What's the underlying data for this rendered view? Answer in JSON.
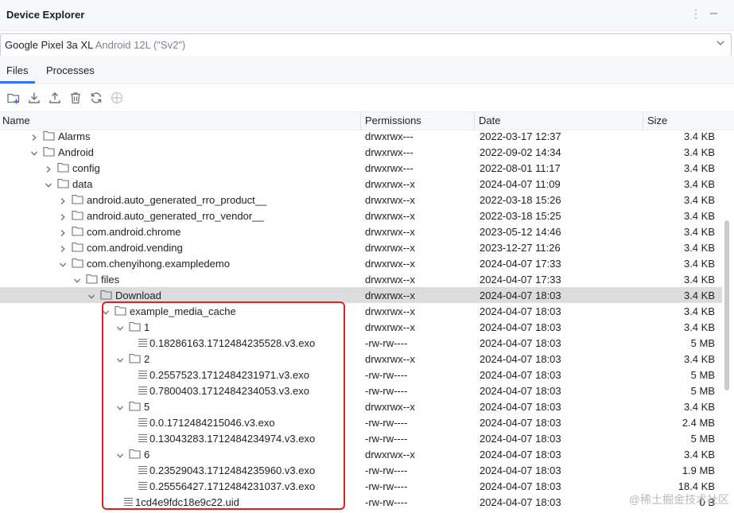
{
  "window": {
    "title": "Device Explorer"
  },
  "device": {
    "name": "Google Pixel 3a XL",
    "version": "Android 12L (\"Sv2\")"
  },
  "tabs": [
    {
      "label": "Files",
      "active": true
    },
    {
      "label": "Processes",
      "active": false
    }
  ],
  "toolbar": {
    "icons": [
      "new-folder-icon",
      "download-icon",
      "upload-icon",
      "delete-icon",
      "sync-icon",
      "stop-icon"
    ]
  },
  "columns": {
    "name": "Name",
    "permissions": "Permissions",
    "date": "Date",
    "size": "Size"
  },
  "rows": [
    {
      "depth": 1,
      "expanded": false,
      "kind": "folder",
      "name": "Alarms",
      "permissions": "drwxrwx---",
      "date": "2022-03-17 12:37",
      "size": "3.4 KB"
    },
    {
      "depth": 1,
      "expanded": true,
      "kind": "folder",
      "name": "Android",
      "permissions": "drwxrwx---",
      "date": "2022-09-02 14:34",
      "size": "3.4 KB"
    },
    {
      "depth": 2,
      "expanded": false,
      "kind": "folder",
      "name": "config",
      "permissions": "drwxrwx---",
      "date": "2022-08-01 11:17",
      "size": "3.4 KB"
    },
    {
      "depth": 2,
      "expanded": true,
      "kind": "folder",
      "name": "data",
      "permissions": "drwxrwx--x",
      "date": "2024-04-07 11:09",
      "size": "3.4 KB"
    },
    {
      "depth": 3,
      "expanded": false,
      "kind": "folder",
      "name": "android.auto_generated_rro_product__",
      "permissions": "drwxrwx--x",
      "date": "2022-03-18 15:26",
      "size": "3.4 KB"
    },
    {
      "depth": 3,
      "expanded": false,
      "kind": "folder",
      "name": "android.auto_generated_rro_vendor__",
      "permissions": "drwxrwx--x",
      "date": "2022-03-18 15:25",
      "size": "3.4 KB"
    },
    {
      "depth": 3,
      "expanded": false,
      "kind": "folder",
      "name": "com.android.chrome",
      "permissions": "drwxrwx--x",
      "date": "2023-05-12 14:46",
      "size": "3.4 KB"
    },
    {
      "depth": 3,
      "expanded": false,
      "kind": "folder",
      "name": "com.android.vending",
      "permissions": "drwxrwx--x",
      "date": "2023-12-27 11:26",
      "size": "3.4 KB"
    },
    {
      "depth": 3,
      "expanded": true,
      "kind": "folder",
      "name": "com.chenyihong.exampledemo",
      "permissions": "drwxrwx--x",
      "date": "2024-04-07 17:33",
      "size": "3.4 KB"
    },
    {
      "depth": 4,
      "expanded": true,
      "kind": "folder",
      "name": "files",
      "permissions": "drwxrwx--x",
      "date": "2024-04-07 17:33",
      "size": "3.4 KB"
    },
    {
      "depth": 5,
      "expanded": true,
      "kind": "folder",
      "name": "Download",
      "permissions": "drwxrwx--x",
      "date": "2024-04-07 18:03",
      "size": "3.4 KB",
      "selected": true
    },
    {
      "depth": 6,
      "expanded": true,
      "kind": "folder",
      "name": "example_media_cache",
      "permissions": "drwxrwx--x",
      "date": "2024-04-07 18:03",
      "size": "3.4 KB"
    },
    {
      "depth": 7,
      "expanded": true,
      "kind": "folder",
      "name": "1",
      "permissions": "drwxrwx--x",
      "date": "2024-04-07 18:03",
      "size": "3.4 KB"
    },
    {
      "depth": 8,
      "expanded": false,
      "kind": "file",
      "name": "0.18286163.1712484235528.v3.exo",
      "permissions": "-rw-rw----",
      "date": "2024-04-07 18:03",
      "size": "5 MB"
    },
    {
      "depth": 7,
      "expanded": true,
      "kind": "folder",
      "name": "2",
      "permissions": "drwxrwx--x",
      "date": "2024-04-07 18:03",
      "size": "3.4 KB"
    },
    {
      "depth": 8,
      "expanded": false,
      "kind": "file",
      "name": "0.2557523.1712484231971.v3.exo",
      "permissions": "-rw-rw----",
      "date": "2024-04-07 18:03",
      "size": "5 MB"
    },
    {
      "depth": 8,
      "expanded": false,
      "kind": "file",
      "name": "0.7800403.1712484234053.v3.exo",
      "permissions": "-rw-rw----",
      "date": "2024-04-07 18:03",
      "size": "5 MB"
    },
    {
      "depth": 7,
      "expanded": true,
      "kind": "folder",
      "name": "5",
      "permissions": "drwxrwx--x",
      "date": "2024-04-07 18:03",
      "size": "3.4 KB"
    },
    {
      "depth": 8,
      "expanded": false,
      "kind": "file",
      "name": "0.0.1712484215046.v3.exo",
      "permissions": "-rw-rw----",
      "date": "2024-04-07 18:03",
      "size": "2.4 MB"
    },
    {
      "depth": 8,
      "expanded": false,
      "kind": "file",
      "name": "0.13043283.1712484234974.v3.exo",
      "permissions": "-rw-rw----",
      "date": "2024-04-07 18:03",
      "size": "5 MB"
    },
    {
      "depth": 7,
      "expanded": true,
      "kind": "folder",
      "name": "6",
      "permissions": "drwxrwx--x",
      "date": "2024-04-07 18:03",
      "size": "3.4 KB"
    },
    {
      "depth": 8,
      "expanded": false,
      "kind": "file",
      "name": "0.23529043.1712484235960.v3.exo",
      "permissions": "-rw-rw----",
      "date": "2024-04-07 18:03",
      "size": "1.9 MB"
    },
    {
      "depth": 8,
      "expanded": false,
      "kind": "file",
      "name": "0.25556427.1712484231037.v3.exo",
      "permissions": "-rw-rw----",
      "date": "2024-04-07 18:03",
      "size": "18.4 KB"
    },
    {
      "depth": 7,
      "expanded": false,
      "kind": "file",
      "name": "1cd4e9fdc18e9c22.uid",
      "permissions": "-rw-rw----",
      "date": "2024-04-07 18:03",
      "size": "0 B"
    }
  ],
  "watermark": "@稀土掘金技术社区",
  "colors": {
    "accent": "#3574f0",
    "highlight_border": "#e02020",
    "selected_row": "#dcdcdc"
  }
}
